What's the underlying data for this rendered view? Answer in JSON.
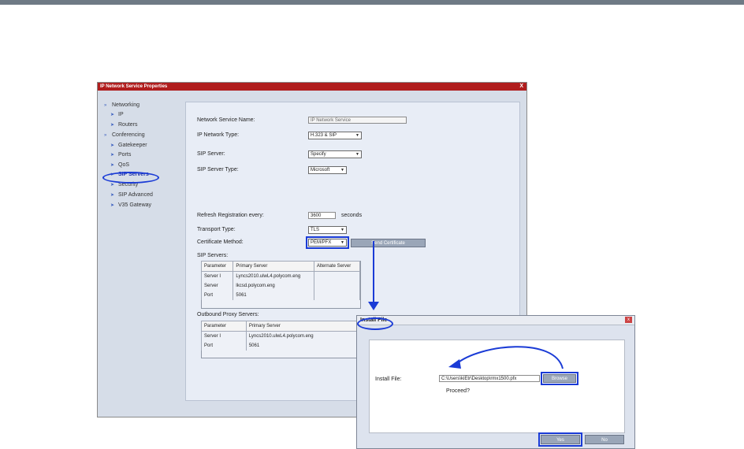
{
  "window": {
    "title": "IP Network Service Properties",
    "close": "X"
  },
  "nav": [
    {
      "label": "Networking",
      "level": "group"
    },
    {
      "label": "IP",
      "level": "sub"
    },
    {
      "label": "Routers",
      "level": "sub"
    },
    {
      "label": "Conferencing",
      "level": "group"
    },
    {
      "label": "Gatekeeper",
      "level": "sub"
    },
    {
      "label": "Ports",
      "level": "sub"
    },
    {
      "label": "QoS",
      "level": "sub"
    },
    {
      "label": "SIP Servers",
      "level": "sub",
      "selected": true
    },
    {
      "label": "Security",
      "level": "sub"
    },
    {
      "label": "SIP Advanced",
      "level": "sub"
    },
    {
      "label": "V35 Gateway",
      "level": "sub"
    }
  ],
  "form": {
    "service_name_label": "Network Service Name:",
    "service_name_value": "IP Network Service",
    "ip_type_label": "IP Network Type:",
    "ip_type_value": "H.323 & SIP",
    "sip_server_label": "SIP Server:",
    "sip_server_value": "Specify",
    "sip_server_type_label": "SIP Server Type:",
    "sip_server_type_value": "Microsoft",
    "refresh_label": "Refresh Registration every:",
    "refresh_value": "3600",
    "refresh_unit": "seconds",
    "transport_label": "Transport Type:",
    "transport_value": "TLS",
    "cert_label": "Certificate Method:",
    "cert_value": "PEM/PFX",
    "send_cert_button": "Send Certificate",
    "sip_servers_label": "SIP Servers:",
    "outbound_label": "Outbound Proxy Servers:"
  },
  "sip_table": {
    "headers": [
      "Parameter",
      "Primary Server",
      "Alternate Server"
    ],
    "rows": [
      [
        "Server I",
        "Lyncs2010.ulwL4.polycom.eng",
        ""
      ],
      [
        "Server",
        "lkcsd.polycom.eng",
        ""
      ],
      [
        "Port",
        "5061",
        ""
      ]
    ]
  },
  "proxy_table": {
    "headers": [
      "Parameter",
      "Primary Server"
    ],
    "rows": [
      [
        "Server I",
        "Lyncs2010.ulwL4.polycom.eng"
      ],
      [
        "Port",
        "5061"
      ]
    ]
  },
  "install_dialog": {
    "title": "Install File",
    "close": "x",
    "install_label": "Install File:",
    "path_value": "C:\\Users\\kiEtr\\Desktop\\rmx1500.pfx",
    "browse_button": "Browse",
    "proceed_text": "Proceed?",
    "yes_button": "Yes",
    "no_button": "No"
  },
  "colors": {
    "title_red": "#b01d1d",
    "highlight_blue": "#1a3bd6"
  }
}
